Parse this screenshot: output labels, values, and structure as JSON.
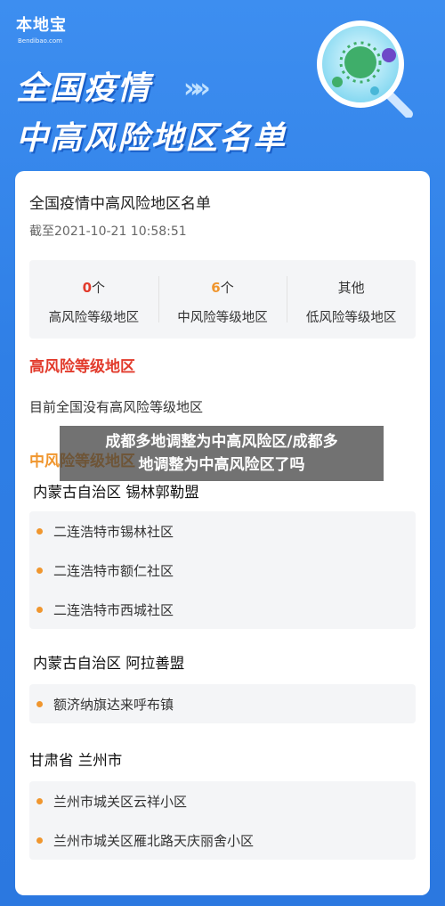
{
  "header": {
    "brand": "本地宝",
    "domain": "Bendibao.com",
    "hero_line1": "全国疫情",
    "hero_line2": "中高风险地区名单",
    "hero_arrows": "»»"
  },
  "card": {
    "title": "全国疫情中高风险地区名单",
    "updated": "截至2021-10-21 10:58:51",
    "stats": [
      {
        "count": "0",
        "unit": "个",
        "label": "高风险等级地区",
        "color": "#e23b2c"
      },
      {
        "count": "6",
        "unit": "个",
        "label": "中风险等级地区",
        "color": "#f0962e"
      },
      {
        "count": "其他",
        "unit": "",
        "label": "低风险等级地区",
        "color": "#333333"
      }
    ],
    "high_risk_title": "高风险等级地区",
    "high_risk_none": "目前全国没有高风险等级地区",
    "mid_risk_title": "中风险等级地区",
    "regions": [
      {
        "name": "内蒙古自治区 锡林郭勒盟",
        "items": [
          "二连浩特市锡林社区",
          "二连浩特市额仁社区",
          "二连浩特市西城社区"
        ]
      },
      {
        "name": "内蒙古自治区 阿拉善盟",
        "items": [
          "额济纳旗达来呼布镇"
        ]
      },
      {
        "name": "甘肃省 兰州市",
        "items": [
          "兰州市城关区云祥小区",
          "兰州市城关区雁北路天庆丽舍小区"
        ]
      }
    ]
  },
  "overlay": {
    "line1": "成都多地调整为中高风险区/成都多",
    "line2": "地调整为中高风险区了吗"
  },
  "colors": {
    "background": "#2f7fe6",
    "high": "#e23b2c",
    "mid": "#f0962e"
  }
}
